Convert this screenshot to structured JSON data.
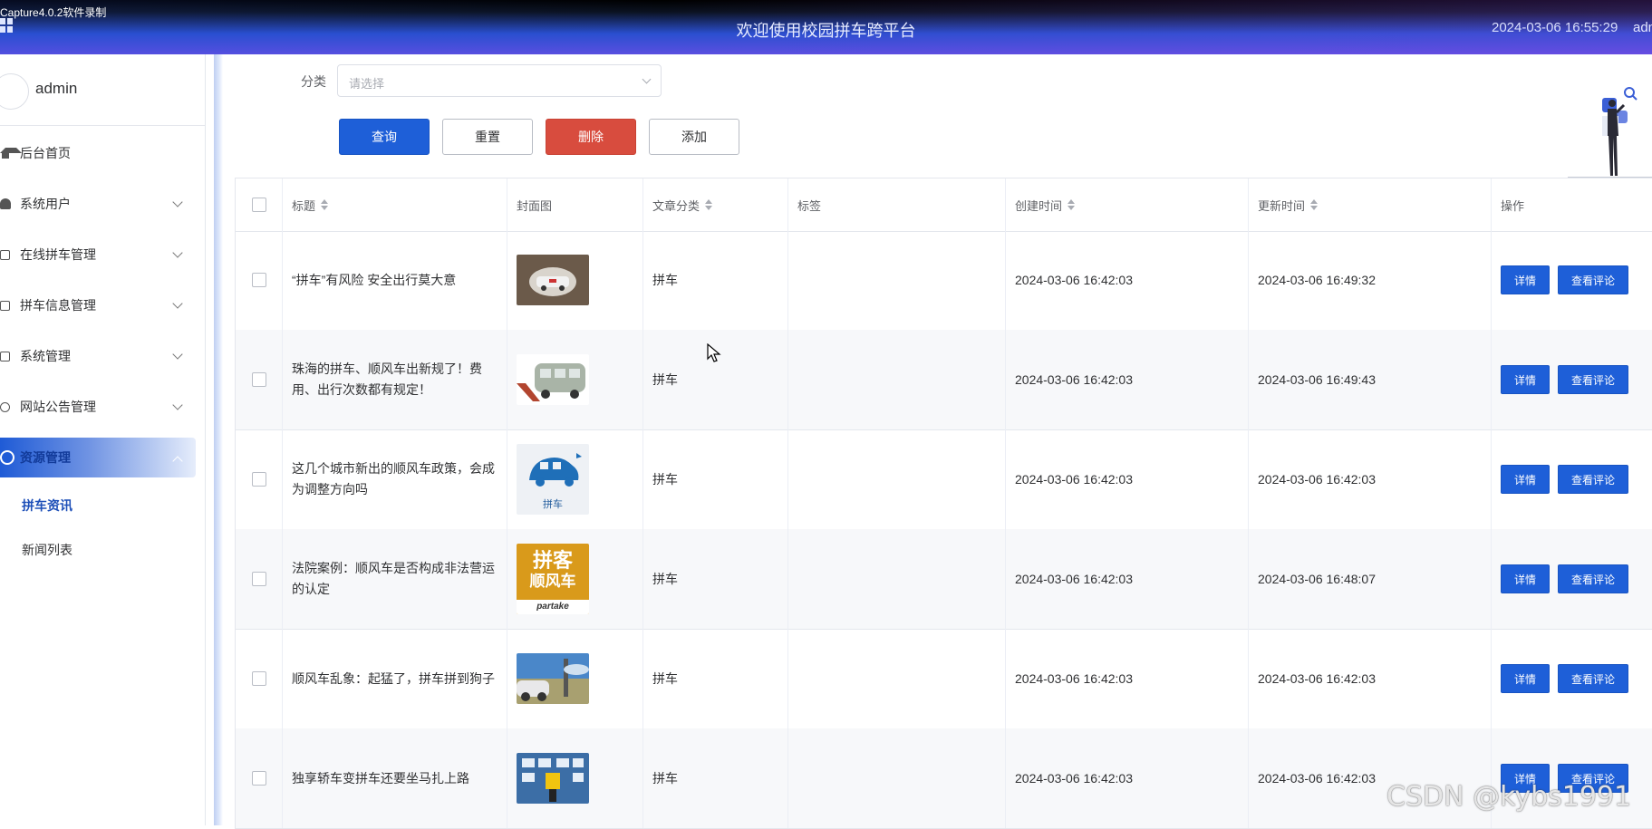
{
  "recorder_label": "Capture4.0.2软件录制",
  "header": {
    "title": "欢迎使用校园拼车跨平台",
    "datetime": "2024-03-06 16:55:29",
    "user": "admin"
  },
  "sidebar": {
    "username": "admin",
    "items": [
      {
        "label": "后台首页",
        "icon": "home-icon"
      },
      {
        "label": "系统用户",
        "icon": "user-icon"
      },
      {
        "label": "在线拼车管理",
        "icon": "board-icon"
      },
      {
        "label": "拼车信息管理",
        "icon": "board-icon"
      },
      {
        "label": "系统管理",
        "icon": "image-icon"
      },
      {
        "label": "网站公告管理",
        "icon": "info-icon"
      },
      {
        "label": "资源管理",
        "icon": "bulb-icon"
      }
    ],
    "subitems": [
      {
        "label": "拼车资讯"
      },
      {
        "label": "新闻列表"
      }
    ]
  },
  "filter": {
    "label": "分类",
    "placeholder": "请选择"
  },
  "buttons": {
    "query": "查询",
    "reset": "重置",
    "delete": "删除",
    "add": "添加"
  },
  "table": {
    "headers": [
      "标题",
      "封面图",
      "文章分类",
      "标签",
      "创建时间",
      "更新时间",
      "操作"
    ],
    "rows": [
      {
        "title": "“拼车”有风险 安全出行莫大意",
        "category": "拼车",
        "tag": "",
        "created": "2024-03-06 16:42:03",
        "updated": "2024-03-06 16:49:32"
      },
      {
        "title": "珠海的拼车、顺风车出新规了！费用、出行次数都有规定！",
        "category": "拼车",
        "tag": "",
        "created": "2024-03-06 16:42:03",
        "updated": "2024-03-06 16:49:43"
      },
      {
        "title": "这几个城市新出的顺风车政策，会成为调整方向吗",
        "category": "拼车",
        "tag": "",
        "created": "2024-03-06 16:42:03",
        "updated": "2024-03-06 16:42:03"
      },
      {
        "title": "法院案例：顺风车是否构成非法营运的认定",
        "category": "拼车",
        "tag": "",
        "created": "2024-03-06 16:42:03",
        "updated": "2024-03-06 16:48:07"
      },
      {
        "title": "顺风车乱象：起猛了，拼车拼到狗子",
        "category": "拼车",
        "tag": "",
        "created": "2024-03-06 16:42:03",
        "updated": "2024-03-06 16:42:03"
      },
      {
        "title": "独享轿车变拼车还要坐马扎上路",
        "category": "拼车",
        "tag": "",
        "created": "2024-03-06 16:42:03",
        "updated": "2024-03-06 16:42:03"
      }
    ],
    "actions": {
      "detail": "详情",
      "comments": "查看评论"
    }
  },
  "covers": {
    "c3_text": "拼车",
    "c4_line1": "拼客",
    "c4_line2": "顺风车",
    "c4_brand": "partake"
  },
  "watermark": "CSDN @kybs1991",
  "colors": {
    "primary": "#1e5fd8",
    "danger": "#d84c3e"
  }
}
